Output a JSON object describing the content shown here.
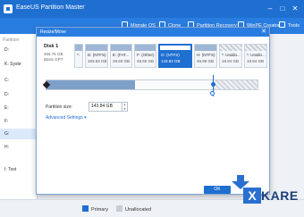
{
  "window": {
    "title": "EaseUS Partition Master",
    "minimize": "–",
    "maximize": "□",
    "close": "✕"
  },
  "toolbar": {
    "items": [
      "Migrate OS",
      "Clone",
      "Partition Recovery",
      "WinPE Creator",
      "Tools"
    ]
  },
  "sidebar": {
    "header": "Partition",
    "rows": [
      "D:",
      "K: Syste",
      "C:",
      "D:",
      "E:",
      "F:",
      "G:",
      "H:",
      "I: Test"
    ]
  },
  "dialog": {
    "title": "Resize/Move",
    "close": "✕",
    "disk": {
      "name": "Disk 1",
      "size": "465.76 GB",
      "type": "Basic GPT"
    },
    "partitions": [
      {
        "name": "*:",
        "size": "",
        "selected": false,
        "unallocated": false
      },
      {
        "name": "D: (NTFS)",
        "size": "193.53 GB",
        "selected": false,
        "unallocated": false
      },
      {
        "name": "E: (FAT...",
        "size": "29.93 GB",
        "selected": false,
        "unallocated": false
      },
      {
        "name": "F: (Other)",
        "size": "49.60 GB",
        "selected": false,
        "unallocated": false
      },
      {
        "name": "G: (NTFS)",
        "size": "143.84 GB",
        "selected": true,
        "unallocated": false
      },
      {
        "name": "H: (NTFS)",
        "size": "49.99 GB",
        "selected": false,
        "unallocated": false
      },
      {
        "name": "*: Unallo...",
        "size": "19.84 GB",
        "selected": false,
        "unallocated": true
      },
      {
        "name": "*: Unallo...",
        "size": "19.84 GB",
        "selected": false,
        "unallocated": true
      }
    ],
    "resize": {
      "used_fraction": 0.42,
      "partition_fraction": 0.79
    },
    "partition_size_label": "Partition size:",
    "partition_size_value": "143.84 GB",
    "advanced_settings": "Advanced Settings ▾",
    "ok": "OK"
  },
  "statusbar": {
    "primary": "Primary",
    "unallocated": "Unallocated"
  },
  "watermark": {
    "letter": "X",
    "text": "KARE"
  },
  "colors": {
    "accent": "#2a7de0",
    "primary_swatch": "#1f6fd1",
    "unalloc_swatch": "#c8ced6"
  }
}
